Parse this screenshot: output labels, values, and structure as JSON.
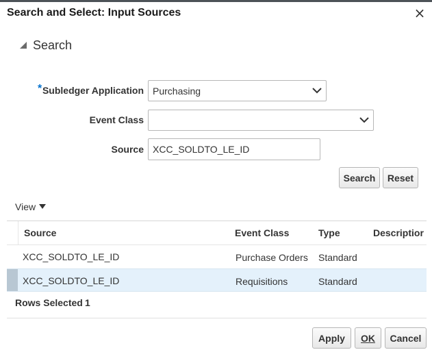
{
  "dialog": {
    "title": "Search and Select: Input Sources",
    "close_glyph": "×"
  },
  "search": {
    "title": "Search",
    "required_marker": "*",
    "fields": {
      "subledger_application": {
        "label": "Subledger Application",
        "value": "Purchasing"
      },
      "event_class": {
        "label": "Event Class",
        "value": ""
      },
      "source": {
        "label": "Source",
        "value": "XCC_SOLDTO_LE_ID"
      }
    },
    "search_button": "Search",
    "reset_button": "Reset"
  },
  "results": {
    "view_menu_label": "View",
    "columns": [
      "Source",
      "Event Class",
      "Type",
      "Descriptior"
    ],
    "rows": [
      {
        "source": "XCC_SOLDTO_LE_ID",
        "event_class": "Purchase Orders",
        "type": "Standard",
        "description": "",
        "selected": false
      },
      {
        "source": "XCC_SOLDTO_LE_ID",
        "event_class": "Requisitions",
        "type": "Standard",
        "description": "",
        "selected": true
      }
    ],
    "rows_selected_label": "Rows Selected",
    "rows_selected_count": "1"
  },
  "footer": {
    "apply_button": "Apply",
    "ok_button": "OK",
    "cancel_button": "Cancel"
  },
  "colors": {
    "selected_row_bg": "#e4f1fb",
    "row_indicator": "#b8c7d3",
    "required_marker": "#0572ce"
  },
  "icons": {
    "close": "close-icon",
    "disclosure": "disclosure-triangle-icon",
    "dropdown": "chevron-down-icon",
    "view_caret": "caret-down-icon"
  }
}
